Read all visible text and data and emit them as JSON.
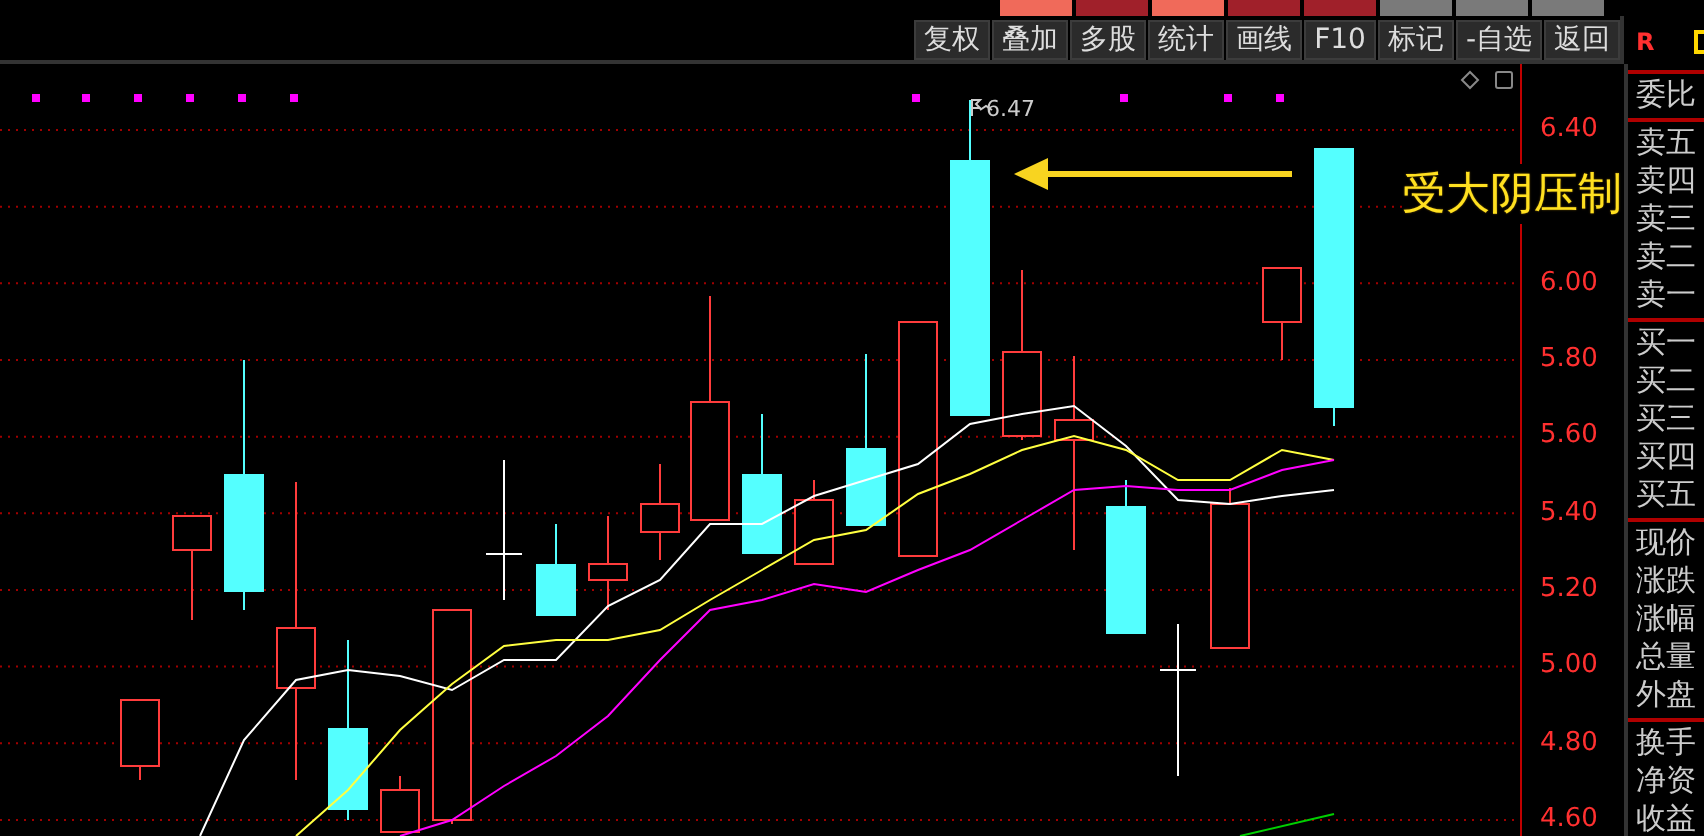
{
  "toolbar": {
    "buttons": [
      "复权",
      "叠加",
      "多股",
      "统计",
      "画线",
      "F10",
      "标记",
      "-自选",
      "返回"
    ]
  },
  "corner_badge": "R",
  "chart": {
    "peak_label": "6.47",
    "annotation": "受大阴压制",
    "price_ticks": [
      "6.40",
      "6.00",
      "5.80",
      "5.60",
      "5.40",
      "5.20",
      "5.00",
      "4.80",
      "4.60"
    ]
  },
  "quote_panel": {
    "groups": [
      [
        "委比"
      ],
      [
        "卖五",
        "卖四",
        "卖三",
        "卖二",
        "卖一"
      ],
      [
        "买一",
        "买二",
        "买三",
        "买四",
        "买五"
      ],
      [
        "现价",
        "涨跌",
        "涨幅",
        "总量",
        "外盘"
      ],
      [
        "换手",
        "净资",
        "收益"
      ]
    ]
  }
}
